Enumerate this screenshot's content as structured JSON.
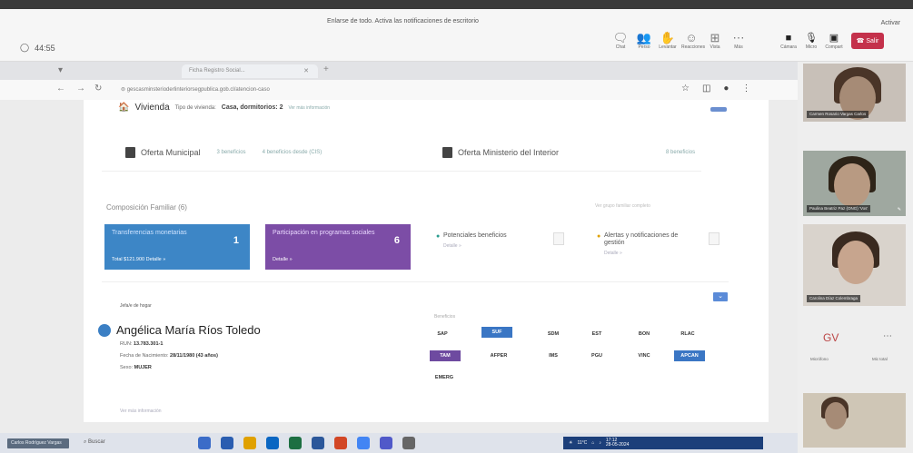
{
  "teams": {
    "notice": "Enlarse de todo. Activa las notificaciones de escritorio",
    "timer": "44:55",
    "activar": "Activar",
    "tools": [
      {
        "icon": "chat-icon",
        "label": "Chat"
      },
      {
        "icon": "people-icon",
        "label": "Perso"
      },
      {
        "icon": "hand-icon",
        "label": "Levantar"
      },
      {
        "icon": "reaction-icon",
        "label": "Reacciones"
      },
      {
        "icon": "view-icon",
        "label": "Vista"
      },
      {
        "icon": "more-icon",
        "label": "Más"
      }
    ],
    "rtools": [
      {
        "icon": "camera-icon",
        "label": "Cámara"
      },
      {
        "icon": "mic-icon",
        "label": "Micro"
      },
      {
        "icon": "share-icon",
        "label": "Compart"
      }
    ],
    "leave_label": "Salir",
    "gv": "GV",
    "gv_left": "Micrófono",
    "gv_right": "Mic total"
  },
  "browser": {
    "tab_title": "Ficha Registro Social...",
    "url": "gescasminsterioderlinteriorsegpublica.gob.cl/atencion-caso"
  },
  "page": {
    "vivienda_title": "Vivienda",
    "vivienda_type_label": "Tipo de vivienda:",
    "vivienda_type_value": "Casa, dormitorios: 2",
    "vivienda_more": "Ver más información",
    "oferta_municipal": "Oferta Municipal",
    "oferta_municipal_l1": "3 beneficios",
    "oferta_municipal_l2": "4 beneficios desde (CIS)",
    "oferta_ministerio": "Oferta Ministerio del Interior",
    "oferta_ministerio_l1": "8 beneficios",
    "comp_title": "Composición Familiar (6)",
    "comp_right": "Ver grupo familiar completo",
    "cards": [
      {
        "title": "Transferencias monetarias",
        "count": "1",
        "sub": "Total $121.900  Detalle »"
      },
      {
        "title": "Participación en programas sociales",
        "count": "6",
        "sub": "Detalle »"
      }
    ],
    "notifs": [
      {
        "title": "Potenciales beneficios",
        "more": "Detalle »"
      },
      {
        "title": "Alertas y notificaciones de gestión",
        "more": "Detalle »"
      }
    ],
    "jefa": "Jefa/e de hogar",
    "person_name": "Angélica María Ríos Toledo",
    "run_label": "RUN:",
    "run_value": "13.783.301-1",
    "birth_label": "Fecha de Nacimiento:",
    "birth_value": "28/11/1980 (43 años)",
    "sex_label": "Sexo:",
    "sex_value": "MUJER",
    "ver_mas": "Ver más información",
    "beneficios_label": "Beneficios",
    "chips": [
      "SAP",
      "SUF",
      "SDM",
      "EST",
      "BON",
      "RLAC",
      "TAM",
      "AFPER",
      "IMS",
      "PGU",
      "VINC",
      "APCAN",
      "EMERG"
    ]
  },
  "taskbar": {
    "label": "Carlos Rodríguez Vargas",
    "search": "Buscar",
    "weather": "11°C",
    "time": "17:12",
    "date": "28-05-2024"
  },
  "rail": {
    "tiles": [
      {
        "name": "Carmen Rosario Vargas Carlos"
      },
      {
        "name": "Paulina Beatriz Paz (ONG) 'Vos'"
      },
      {
        "name": "Carolina Díaz Colembraga"
      }
    ]
  }
}
